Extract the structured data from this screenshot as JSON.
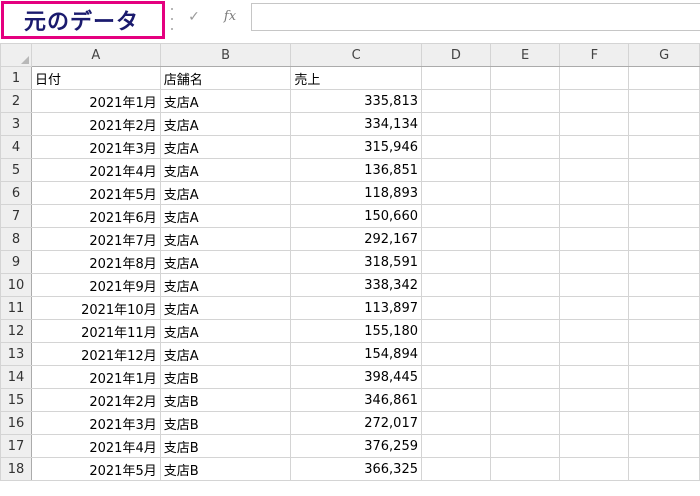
{
  "overlay_label": "元のデータ",
  "formula_bar": {
    "cancel_icon": "check-icon",
    "fx_label": "fx",
    "value": ""
  },
  "columns": [
    "A",
    "B",
    "C",
    "D",
    "E",
    "F",
    "G"
  ],
  "rows": [
    {
      "num": "1",
      "a": "日付",
      "b": "店舗名",
      "c": "売上"
    },
    {
      "num": "2",
      "a": "2021年1月",
      "b": "支店A",
      "c": "335,813"
    },
    {
      "num": "3",
      "a": "2021年2月",
      "b": "支店A",
      "c": "334,134"
    },
    {
      "num": "4",
      "a": "2021年3月",
      "b": "支店A",
      "c": "315,946"
    },
    {
      "num": "5",
      "a": "2021年4月",
      "b": "支店A",
      "c": "136,851"
    },
    {
      "num": "6",
      "a": "2021年5月",
      "b": "支店A",
      "c": "118,893"
    },
    {
      "num": "7",
      "a": "2021年6月",
      "b": "支店A",
      "c": "150,660"
    },
    {
      "num": "8",
      "a": "2021年7月",
      "b": "支店A",
      "c": "292,167"
    },
    {
      "num": "9",
      "a": "2021年8月",
      "b": "支店A",
      "c": "318,591"
    },
    {
      "num": "10",
      "a": "2021年9月",
      "b": "支店A",
      "c": "338,342"
    },
    {
      "num": "11",
      "a": "2021年10月",
      "b": "支店A",
      "c": "113,897"
    },
    {
      "num": "12",
      "a": "2021年11月",
      "b": "支店A",
      "c": "155,180"
    },
    {
      "num": "13",
      "a": "2021年12月",
      "b": "支店A",
      "c": "154,894"
    },
    {
      "num": "14",
      "a": "2021年1月",
      "b": "支店B",
      "c": "398,445"
    },
    {
      "num": "15",
      "a": "2021年2月",
      "b": "支店B",
      "c": "346,861"
    },
    {
      "num": "16",
      "a": "2021年3月",
      "b": "支店B",
      "c": "272,017"
    },
    {
      "num": "17",
      "a": "2021年4月",
      "b": "支店B",
      "c": "376,259"
    },
    {
      "num": "18",
      "a": "2021年5月",
      "b": "支店B",
      "c": "366,325"
    }
  ]
}
